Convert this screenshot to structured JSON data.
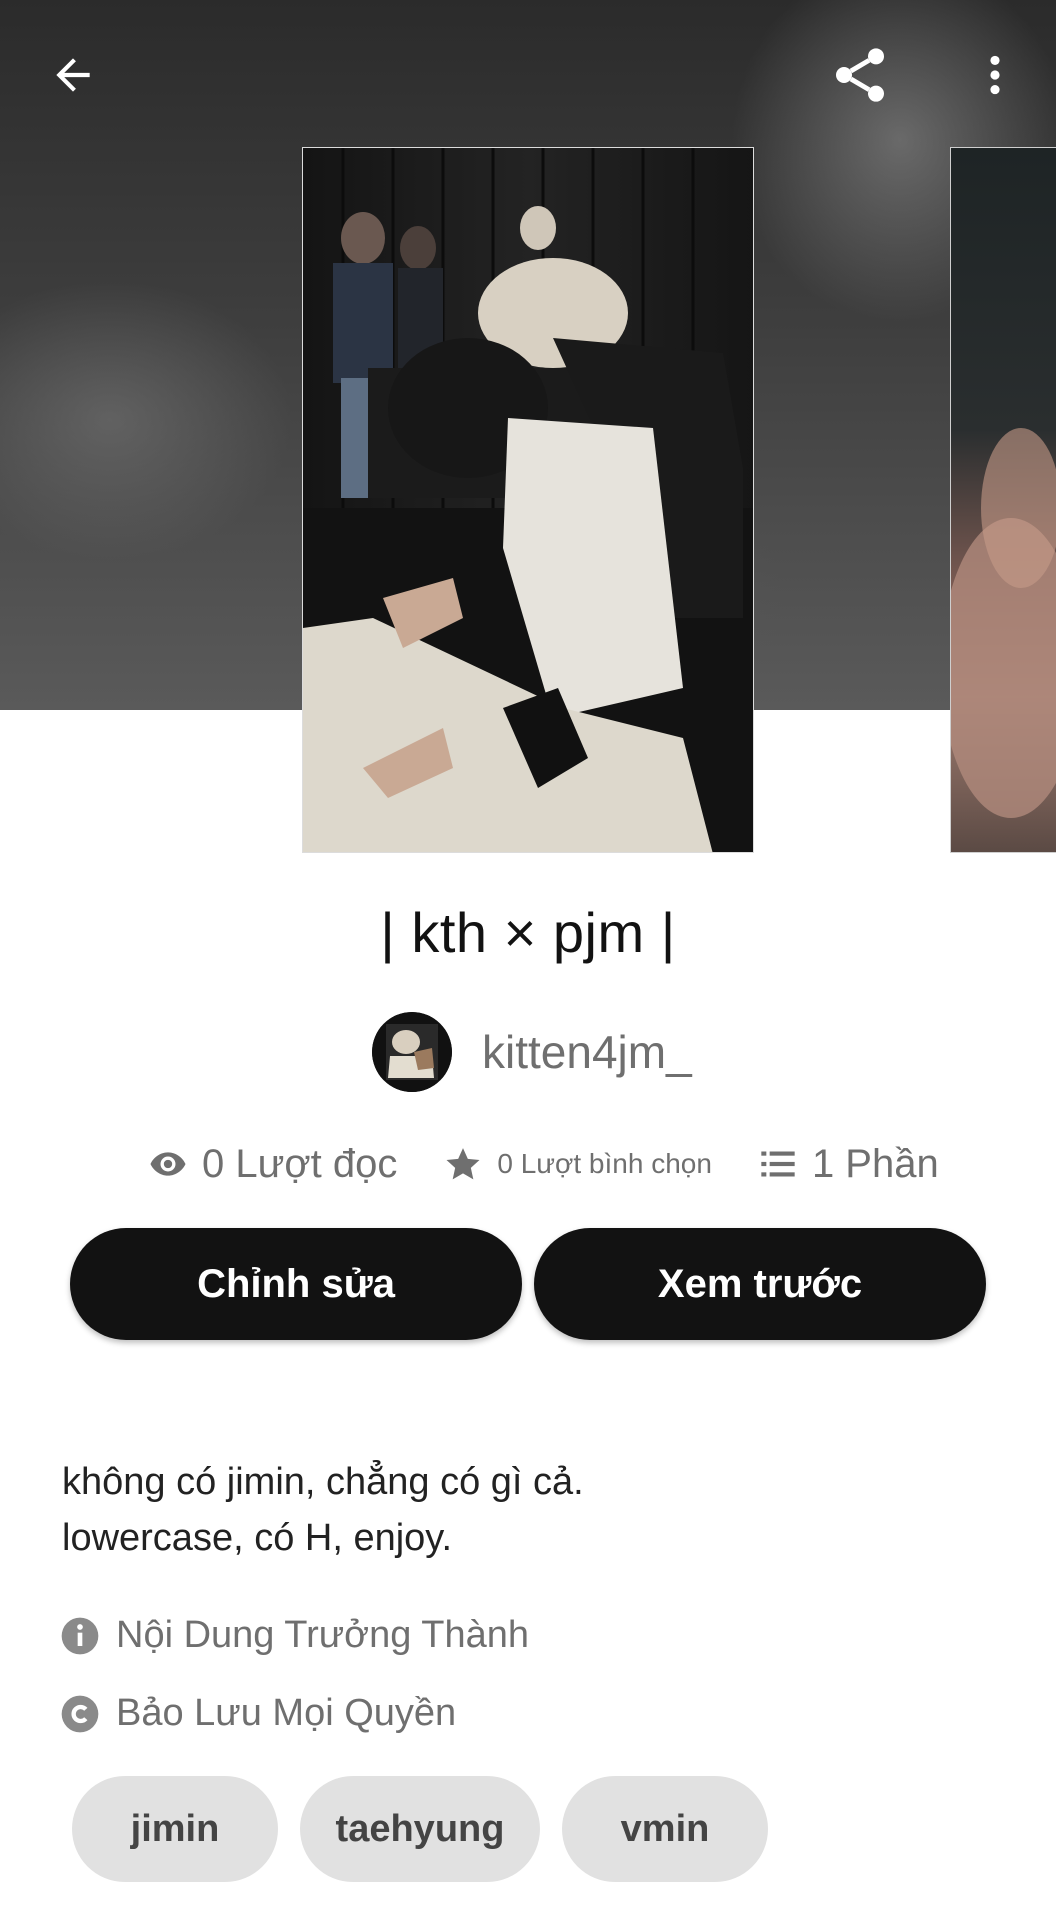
{
  "story": {
    "title": "| kth × pjm |",
    "author": "kitten4jm_",
    "description_lines": [
      "không có jimin, chẳng có gì cả.",
      "lowercase, có H, enjoy."
    ]
  },
  "stats": {
    "reads": "0 Lượt đọc",
    "votes": "0 Lượt bình chọn",
    "parts": "1 Phần"
  },
  "buttons": {
    "edit": "Chỉnh sửa",
    "preview": "Xem trước"
  },
  "info": {
    "mature": "Nội Dung Trưởng Thành",
    "copyright": "Bảo Lưu Mọi Quyền"
  },
  "tags": [
    "jimin",
    "taehyung",
    "vmin"
  ],
  "icons": {
    "back": "arrow-left-icon",
    "share": "share-icon",
    "more": "more-vertical-icon",
    "reads": "eye-icon",
    "votes": "star-icon",
    "parts": "list-icon",
    "mature": "info-icon",
    "copyright": "copyright-icon"
  },
  "colors": {
    "button_bg": "#121212",
    "button_text": "#ffffff",
    "secondary_text": "#6f6f6f",
    "tag_bg": "#e1e1e1"
  }
}
